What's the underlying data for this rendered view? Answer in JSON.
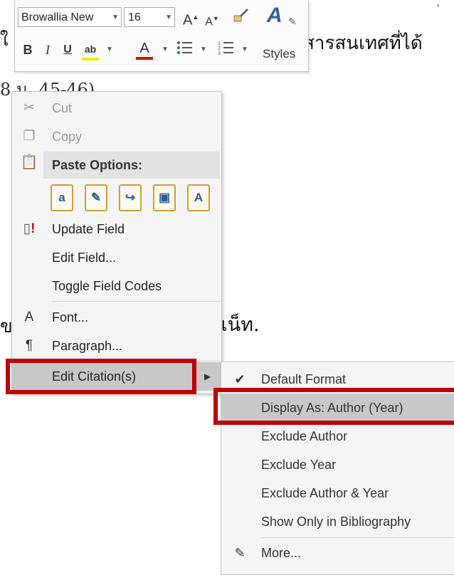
{
  "document": {
    "line0": "ใ",
    "line1": "สารสนเทศที่ได้",
    "line2": "8 น. 45-46)",
    "line3_left": "ข",
    "line3_right": "ร์เน็ท.",
    "mark": "่"
  },
  "mini_toolbar": {
    "font_name": "Browallia New",
    "font_size": "16",
    "grow_font": "A",
    "shrink_font": "A",
    "bold": "B",
    "italic": "I",
    "underline": "U",
    "highlight": "ab",
    "font_color": "A",
    "styles_label": "Styles",
    "highlight_color": "#f2e900",
    "font_color_value": "#e00000"
  },
  "context_menu": {
    "cut": "Cut",
    "copy": "Copy",
    "paste_options": "Paste Options:",
    "paste_option_glyphs": [
      "a",
      "✎",
      "↪",
      "▣",
      "A"
    ],
    "update_field": "Update Field",
    "edit_field": "Edit Field...",
    "toggle_field_codes": "Toggle Field Codes",
    "font": "Font...",
    "paragraph": "Paragraph...",
    "edit_citations": "Edit Citation(s)"
  },
  "submenu": {
    "default_format": "Default Format",
    "display_as": "Display As: Author (Year)",
    "exclude_author": "Exclude Author",
    "exclude_year": "Exclude Year",
    "exclude_author_year": "Exclude Author & Year",
    "show_only_bibliography": "Show Only in Bibliography",
    "more": "More..."
  },
  "colors": {
    "highlight_box": "#c00000",
    "menu_bg": "#f5f5f5",
    "selected_bg": "#c8c8c8"
  }
}
